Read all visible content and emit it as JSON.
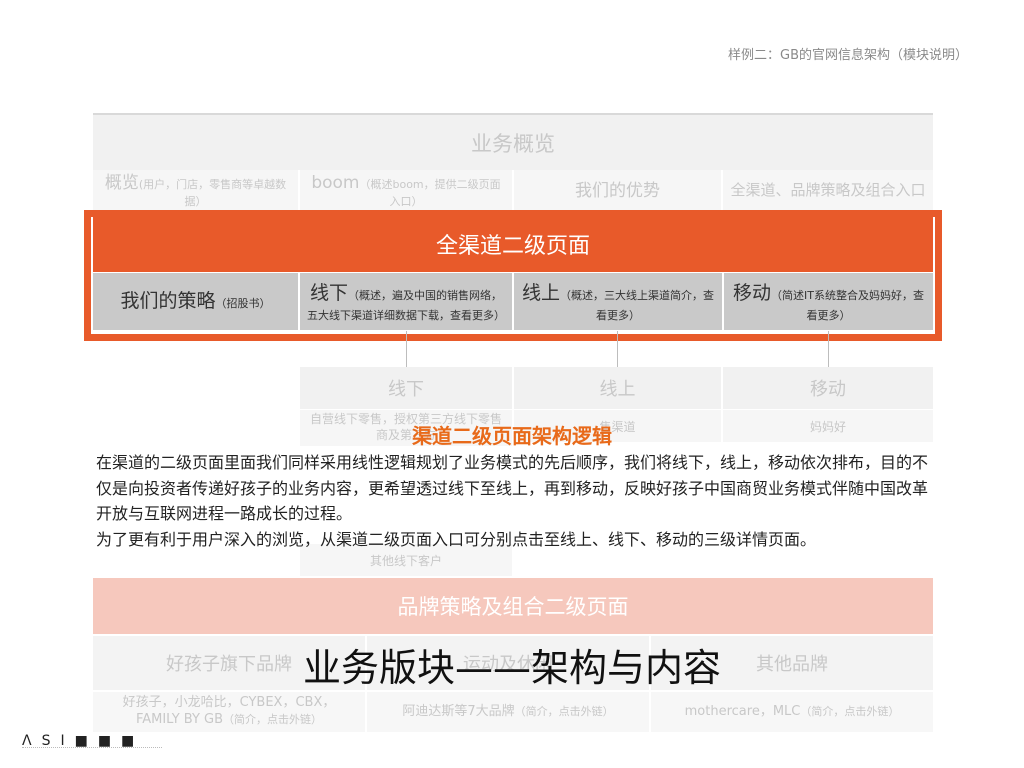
{
  "page_title": "样例二：GB的官网信息架构（模块说明）",
  "section1": {
    "title": "业务概览",
    "cells": [
      {
        "title": "概览",
        "note": "(用户，门店，零售商等卓越数据）"
      },
      {
        "title": "boom",
        "note": "（概述boom，提供二级页面入口）"
      },
      {
        "title": "我们的优势",
        "note": ""
      },
      {
        "title": "全渠道、品牌策略及组合入口",
        "note": ""
      }
    ]
  },
  "highlight": {
    "title": "全渠道二级页面",
    "cells": [
      {
        "title": "我们的策略",
        "note": "（招股书）"
      },
      {
        "title": "线下",
        "note": "（概述，遍及中国的销售网络，五大线下渠道详细数据下载，查看更多）"
      },
      {
        "title": "线上",
        "note": "（概述，三大线上渠道简介，查看更多）"
      },
      {
        "title": "移动",
        "note": "（简述IT系统整合及妈妈好，查看更多）"
      }
    ]
  },
  "sub_columns": {
    "offline": {
      "title": "线下",
      "items": [
        "自营线下零售，授权第三方线下零售商及第三方",
        "其他线下客户"
      ]
    },
    "online": {
      "title": "线上",
      "items": [
        "售渠道"
      ]
    },
    "mobile": {
      "title": "移动",
      "items": [
        "妈妈好"
      ]
    }
  },
  "logic": {
    "title": "渠道二级页面架构逻辑",
    "paragraph1": "在渠道的二级页面里面我们同样采用线性逻辑规划了业务模式的先后顺序，我们将线下，线上，移动依次排布，目的不仅是向投资者传递好孩子的业务内容，更希望透过线下至线上，再到移动，反映好孩子中国商贸业务模式伴随中国改革开放与互联网进程一路成长的过程。",
    "paragraph2": "为了更有利于用户深入的浏览，从渠道二级页面入口可分别点击至线上、线下、移动的三级详情页面。"
  },
  "section2": {
    "title": "品牌策略及组合二级页面",
    "row": [
      "好孩子旗下品牌",
      "运动及休闲",
      "其他品牌"
    ],
    "details": [
      {
        "text": "好孩子，小龙哈比，CYBEX，CBX，FAMILY BY GB",
        "note": "（简介，点击外链）"
      },
      {
        "text": "阿迪达斯等7大品牌",
        "note": "（简介，点击外链）"
      },
      {
        "text": "mothercare，MLC",
        "note": "（简介，点击外链）"
      }
    ]
  },
  "caption": "业务版块——架构与内容",
  "logo": "ΛSI■■■",
  "colors": {
    "accent": "#e85a2a",
    "accent_light": "#f6c8bd",
    "logic_title": "#e86a1a"
  }
}
